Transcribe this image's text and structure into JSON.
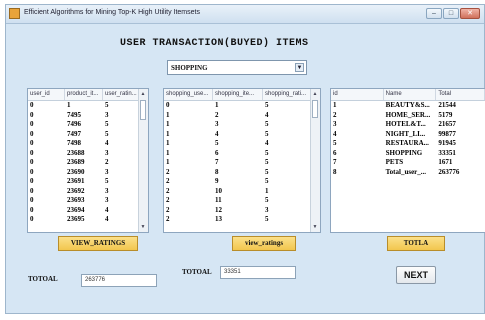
{
  "window": {
    "title": "Efficient Algorithms for Mining Top-K High Utility Itemsets",
    "min_glyph": "–",
    "max_glyph": "□",
    "close_glyph": "✕"
  },
  "heading": "USER TRANSACTION(BUYED) ITEMS",
  "category_select": {
    "value": "SHOPPING"
  },
  "ratings_table": {
    "columns": [
      "user_id",
      "product_it...",
      "user_ratin..."
    ],
    "rows": [
      [
        "0",
        "1",
        "5"
      ],
      [
        "0",
        "7495",
        "3"
      ],
      [
        "0",
        "7496",
        "5"
      ],
      [
        "0",
        "7497",
        "5"
      ],
      [
        "0",
        "7498",
        "4"
      ],
      [
        "0",
        "23688",
        "3"
      ],
      [
        "0",
        "23689",
        "2"
      ],
      [
        "0",
        "23690",
        "3"
      ],
      [
        "0",
        "23691",
        "5"
      ],
      [
        "0",
        "23692",
        "3"
      ],
      [
        "0",
        "23693",
        "3"
      ],
      [
        "0",
        "23694",
        "4"
      ],
      [
        "0",
        "23695",
        "4"
      ]
    ]
  },
  "shopping_table": {
    "columns": [
      "shopping_use...",
      "shopping_ite...",
      "shopping_rati..."
    ],
    "rows": [
      [
        "0",
        "1",
        "5"
      ],
      [
        "1",
        "2",
        "4"
      ],
      [
        "1",
        "3",
        "5"
      ],
      [
        "1",
        "4",
        "5"
      ],
      [
        "1",
        "5",
        "4"
      ],
      [
        "1",
        "6",
        "5"
      ],
      [
        "1",
        "7",
        "5"
      ],
      [
        "2",
        "8",
        "5"
      ],
      [
        "2",
        "9",
        "5"
      ],
      [
        "2",
        "10",
        "1"
      ],
      [
        "2",
        "11",
        "5"
      ],
      [
        "2",
        "12",
        "3"
      ],
      [
        "2",
        "13",
        "5"
      ]
    ]
  },
  "totals_table": {
    "columns": [
      "id",
      "Name",
      "Total"
    ],
    "rows": [
      [
        "1",
        "BEAUTY&S...",
        "21544"
      ],
      [
        "2",
        "HOME_SER...",
        "5179"
      ],
      [
        "3",
        "HOTEL&T...",
        "21657"
      ],
      [
        "4",
        "NIGHT_LI...",
        "99877"
      ],
      [
        "5",
        "RESTAURA...",
        "91945"
      ],
      [
        "6",
        "SHOPPING",
        "33351"
      ],
      [
        "7",
        "PETS",
        "1671"
      ],
      [
        "8",
        "Total_user_...",
        "263776"
      ]
    ]
  },
  "buttons": {
    "view_ratings_upper": "VIEW_RATINGS",
    "view_ratings_lower": "view_ratings",
    "totla": "TOTLA",
    "next": "NEXT"
  },
  "totals": {
    "label_left": "TOTOAL",
    "value_left": "263776",
    "label_middle": "TOTOAL",
    "value_middle": "33351"
  },
  "icons": {
    "scroll_up": "▲",
    "scroll_down": "▼",
    "dropdown": "▼"
  },
  "colors": {
    "window_bg": "#d6e6f4",
    "button_yellow": "#f2c64e"
  }
}
